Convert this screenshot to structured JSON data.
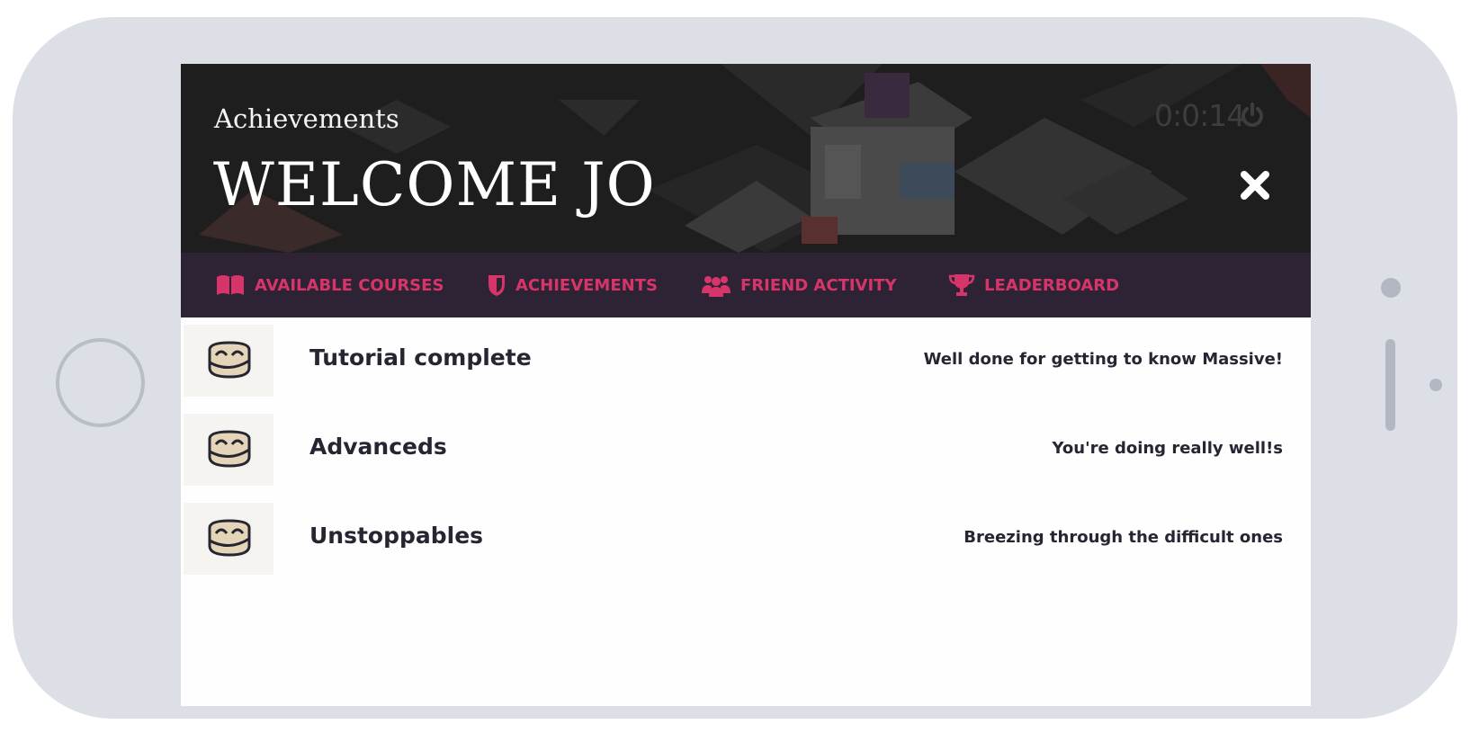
{
  "header": {
    "subtitle": "Achievements",
    "title": "WELCOME JO",
    "timer": "0:0:14"
  },
  "nav": {
    "items": [
      {
        "label": "AVAILABLE COURSES",
        "icon": "book-icon"
      },
      {
        "label": "ACHIEVEMENTS",
        "icon": "shield-icon"
      },
      {
        "label": "FRIEND ACTIVITY",
        "icon": "users-icon"
      },
      {
        "label": "LEADERBOARD",
        "icon": "trophy-icon"
      }
    ]
  },
  "achievements": [
    {
      "title": "Tutorial complete",
      "description": "Well done for getting to know Massive!",
      "icon": "owl-icon"
    },
    {
      "title": "Advanceds",
      "description": "You're doing really well!s",
      "icon": "owl-icon"
    },
    {
      "title": "Unstoppables",
      "description": "Breezing through the difficult ones",
      "icon": "owl-icon"
    }
  ],
  "colors": {
    "accent": "#d7356a",
    "navbar": "#2e2334",
    "hero": "#1e1e1f",
    "text": "#262633",
    "device": "#dcdfe6"
  }
}
